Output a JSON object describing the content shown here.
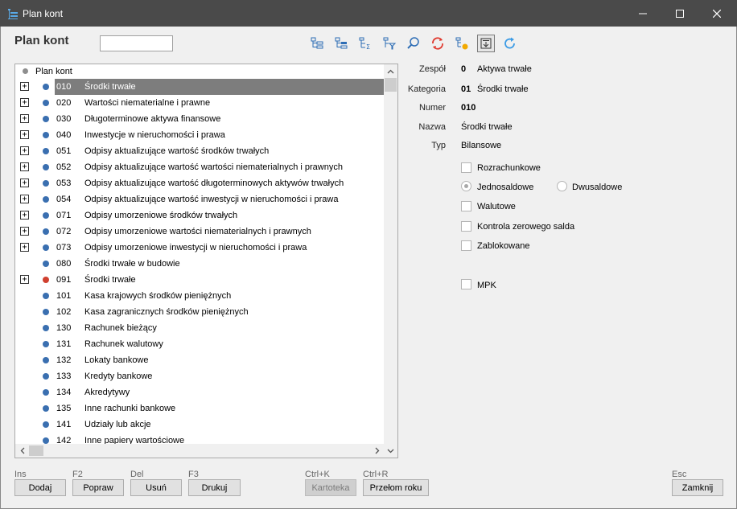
{
  "window": {
    "title": "Plan kont"
  },
  "header": {
    "title": "Plan kont",
    "search": {
      "value": "",
      "placeholder": ""
    }
  },
  "toolbar": {
    "icons": [
      "tree-expand-icon",
      "tree-collapse-icon",
      "sort-tree-icon",
      "filter-tree-icon",
      "search-icon",
      "refresh-red-icon",
      "account-settings-icon",
      "export-down-icon",
      "refresh-blue-icon"
    ],
    "pressed_index": 7
  },
  "tree": {
    "root_label": "Plan kont",
    "rows": [
      {
        "code": "010",
        "name": "Środki trwałe",
        "expandable": true,
        "dot": "#3a6fb0",
        "selected": true
      },
      {
        "code": "020",
        "name": "Wartości niematerialne i prawne",
        "expandable": true,
        "dot": "#3a6fb0"
      },
      {
        "code": "030",
        "name": "Długoterminowe aktywa finansowe",
        "expandable": true,
        "dot": "#3a6fb0"
      },
      {
        "code": "040",
        "name": "Inwestycje w nieruchomości i prawa",
        "expandable": true,
        "dot": "#3a6fb0"
      },
      {
        "code": "051",
        "name": "Odpisy aktualizujące wartość środków trwałych",
        "expandable": true,
        "dot": "#3a6fb0"
      },
      {
        "code": "052",
        "name": "Odpisy aktualizujące wartość wartości niematerialnych i prawnych",
        "expandable": true,
        "dot": "#3a6fb0"
      },
      {
        "code": "053",
        "name": "Odpisy aktualizujące wartość długoterminowych aktywów trwałych",
        "expandable": true,
        "dot": "#3a6fb0"
      },
      {
        "code": "054",
        "name": "Odpisy aktualizujące wartość inwestycji w nieruchomości i prawa",
        "expandable": true,
        "dot": "#3a6fb0"
      },
      {
        "code": "071",
        "name": "Odpisy umorzeniowe środków trwałych",
        "expandable": true,
        "dot": "#3a6fb0"
      },
      {
        "code": "072",
        "name": "Odpisy umorzeniowe wartości niematerialnych i prawnych",
        "expandable": true,
        "dot": "#3a6fb0"
      },
      {
        "code": "073",
        "name": "Odpisy umorzeniowe inwestycji w nieruchomości i prawa",
        "expandable": true,
        "dot": "#3a6fb0"
      },
      {
        "code": "080",
        "name": "Środki trwałe w budowie",
        "expandable": false,
        "dot": "#3a6fb0"
      },
      {
        "code": "091",
        "name": "Środki trwałe",
        "expandable": true,
        "dot": "#d0402f"
      },
      {
        "code": "101",
        "name": "Kasa krajowych środków pieniężnych",
        "expandable": false,
        "dot": "#3a6fb0"
      },
      {
        "code": "102",
        "name": "Kasa zagranicznych środków pieniężnych",
        "expandable": false,
        "dot": "#3a6fb0"
      },
      {
        "code": "130",
        "name": "Rachunek bieżący",
        "expandable": false,
        "dot": "#3a6fb0"
      },
      {
        "code": "131",
        "name": "Rachunek walutowy",
        "expandable": false,
        "dot": "#3a6fb0"
      },
      {
        "code": "132",
        "name": "Lokaty bankowe",
        "expandable": false,
        "dot": "#3a6fb0"
      },
      {
        "code": "133",
        "name": "Kredyty bankowe",
        "expandable": false,
        "dot": "#3a6fb0"
      },
      {
        "code": "134",
        "name": "Akredytywy",
        "expandable": false,
        "dot": "#3a6fb0"
      },
      {
        "code": "135",
        "name": "Inne rachunki bankowe",
        "expandable": false,
        "dot": "#3a6fb0"
      },
      {
        "code": "141",
        "name": "Udziały lub akcje",
        "expandable": false,
        "dot": "#3a6fb0"
      },
      {
        "code": "142",
        "name": "Inne papiery wartościowe",
        "expandable": false,
        "dot": "#3a6fb0"
      }
    ]
  },
  "details": {
    "zespol": {
      "label": "Zespół",
      "code": "0",
      "name": "Aktywa trwałe"
    },
    "kategoria": {
      "label": "Kategoria",
      "code": "01",
      "name": "Środki trwałe"
    },
    "numer": {
      "label": "Numer",
      "value": "010"
    },
    "nazwa": {
      "label": "Nazwa",
      "value": "Środki trwałe"
    },
    "typ": {
      "label": "Typ",
      "value": "Bilansowe"
    },
    "options": {
      "rozrachunkowe": "Rozrachunkowe",
      "jednosaldowe": "Jednosaldowe",
      "dwusaldowe": "Dwusaldowe",
      "walutowe": "Walutowe",
      "kontrola": "Kontrola zerowego salda",
      "zablokowane": "Zablokowane",
      "mpk": "MPK"
    }
  },
  "footer": {
    "dodaj": {
      "shortcut": "Ins",
      "label": "Dodaj"
    },
    "popraw": {
      "shortcut": "F2",
      "label": "Popraw"
    },
    "usun": {
      "shortcut": "Del",
      "label": "Usuń"
    },
    "drukuj": {
      "shortcut": "F3",
      "label": "Drukuj"
    },
    "kartoteka": {
      "shortcut": "Ctrl+K",
      "label": "Kartoteka"
    },
    "przelom": {
      "shortcut": "Ctrl+R",
      "label": "Przełom roku"
    },
    "zamknij": {
      "shortcut": "Esc",
      "label": "Zamknij"
    }
  }
}
